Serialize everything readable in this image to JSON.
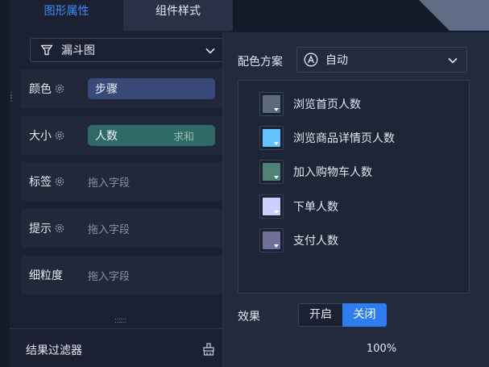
{
  "tabs": [
    {
      "label": "图形属性",
      "active": true
    },
    {
      "label": "组件样式",
      "active": false
    }
  ],
  "chart_type": {
    "icon": "funnel-icon",
    "label": "漏斗图"
  },
  "fields": [
    {
      "label": "颜色",
      "has_gear": true,
      "pill": "步骤",
      "pill_color": "#3a4a78"
    },
    {
      "label": "大小",
      "has_gear": true,
      "pill": "人数",
      "aggregate": "求和",
      "pill_color": "#2f6b66"
    },
    {
      "label": "标签",
      "has_gear": true,
      "placeholder": "拖入字段"
    },
    {
      "label": "提示",
      "has_gear": true,
      "placeholder": "拖入字段"
    },
    {
      "label": "细粒度",
      "has_gear": false,
      "placeholder": "拖入字段"
    }
  ],
  "result_filter": {
    "label": "结果过滤器",
    "icon": "broom-icon"
  },
  "color_popup": {
    "scheme_label": "配色方案",
    "scheme_value": "自动",
    "scheme_icon": "auto-a-icon",
    "items": [
      {
        "label": "浏览首页人数",
        "color": "#5b6a7e"
      },
      {
        "label": "浏览商品详情页人数",
        "color": "#64c3ff"
      },
      {
        "label": "加入购物车人数",
        "color": "#4f8178"
      },
      {
        "label": "下单人数",
        "color": "#c9d1ff"
      },
      {
        "label": "支付人数",
        "color": "#6f6f99"
      }
    ],
    "effect_label": "效果",
    "effect_on": "开启",
    "effect_off": "关闭",
    "effect_selected": "关闭",
    "zoom": "100%"
  },
  "colors": {
    "accent": "#2f7cf0",
    "tab_active_text": "#3d8bf6"
  }
}
